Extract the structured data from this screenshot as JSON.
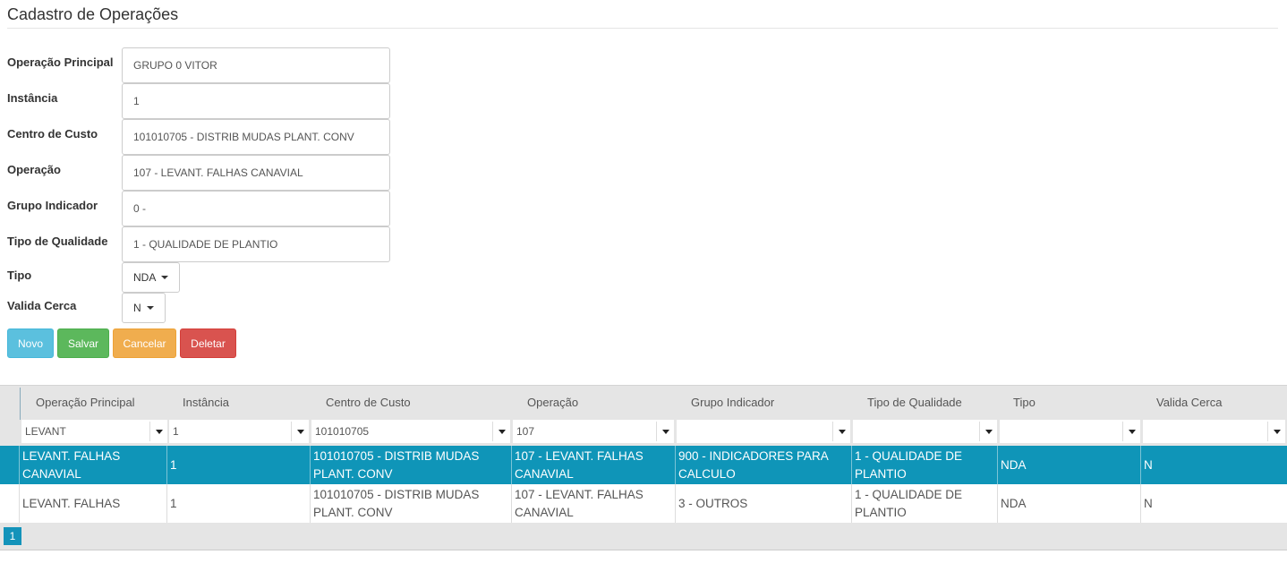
{
  "page": {
    "title": "Cadastro de Operações"
  },
  "form": {
    "fields": [
      {
        "label": "Operação Principal",
        "value": "GRUPO 0 VITOR"
      },
      {
        "label": "Instância",
        "value": "1"
      },
      {
        "label": "Centro de Custo",
        "value": "101010705 - DISTRIB MUDAS PLANT. CONV"
      },
      {
        "label": "Operação",
        "value": "107 - LEVANT. FALHAS CANAVIAL"
      },
      {
        "label": "Grupo Indicador",
        "value": "0 -"
      },
      {
        "label": "Tipo de Qualidade",
        "value": "1 - QUALIDADE DE PLANTIO"
      }
    ],
    "tipo": {
      "label": "Tipo",
      "value": "NDA"
    },
    "valida_cerca": {
      "label": "Valida Cerca",
      "value": "N"
    }
  },
  "buttons": {
    "novo": "Novo",
    "salvar": "Salvar",
    "cancelar": "Cancelar",
    "deletar": "Deletar"
  },
  "grid": {
    "columns": [
      "Operação Principal",
      "Instância",
      "Centro de Custo",
      "Operação",
      "Grupo Indicador",
      "Tipo de Qualidade",
      "Tipo",
      "Valida Cerca"
    ],
    "filters": [
      "LEVANT",
      "1",
      "101010705",
      "107",
      "",
      "",
      "",
      ""
    ],
    "rows": [
      [
        "LEVANT. FALHAS CANAVIAL",
        "1",
        "101010705 - DISTRIB MUDAS PLANT. CONV",
        "107 - LEVANT. FALHAS CANAVIAL",
        "900 - INDICADORES PARA CALCULO",
        "1 - QUALIDADE DE PLANTIO",
        "NDA",
        "N"
      ],
      [
        "LEVANT. FALHAS",
        "1",
        "101010705 - DISTRIB MUDAS PLANT. CONV",
        "107 - LEVANT. FALHAS CANAVIAL",
        "3 - OUTROS",
        "1 - QUALIDADE DE PLANTIO",
        "NDA",
        "N"
      ]
    ],
    "page": "1"
  },
  "colors": {
    "selected_row": "#0f95b8",
    "novo": "#5bc0de",
    "salvar": "#5cb85c",
    "cancelar": "#f0ad4e",
    "deletar": "#d9534f"
  }
}
